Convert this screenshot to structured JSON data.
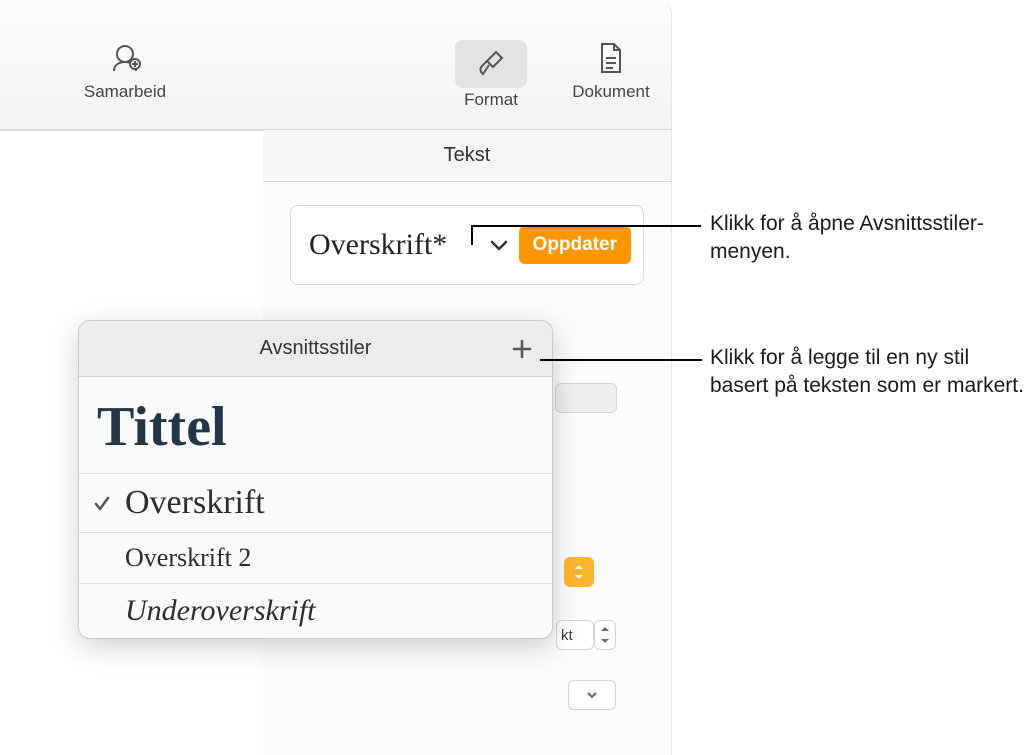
{
  "toolbar": {
    "samarbeid": "Samarbeid",
    "format": "Format",
    "dokument": "Dokument"
  },
  "tabs": {
    "tekst": "Tekst"
  },
  "style_selector": {
    "current": "Overskrift*",
    "update_button": "Oppdater"
  },
  "popover": {
    "title": "Avsnittsstiler",
    "items": {
      "tittel": "Tittel",
      "overskrift": "Overskrift",
      "overskrift2": "Overskrift 2",
      "underoverskrift": "Underoverskrift"
    }
  },
  "side_fragment": {
    "kt": "kt"
  },
  "callouts": {
    "open_menu": "Klikk for å åpne Avsnittsstiler-menyen.",
    "add_style": "Klikk for å legge til en ny stil basert på teksten som er markert."
  }
}
